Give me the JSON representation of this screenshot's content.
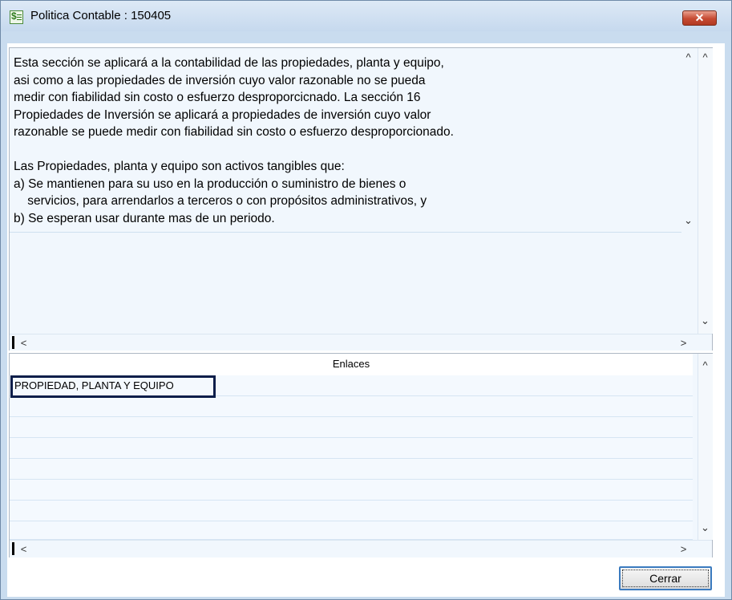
{
  "window": {
    "title": "Politica Contable : 150405",
    "close_label": "✕"
  },
  "policy_text": "Esta sección se aplicará a la contabilidad de las propiedades, planta y equipo,\nasi como a las propiedades de inversión cuyo valor razonable no se pueda\nmedir con fiabilidad sin costo o esfuerzo desproporcicnado. La sección 16\nPropiedades de Inversión se aplicará a propiedades de inversión cuyo valor\nrazonable se puede medir con fiabilidad sin costo o esfuerzo desproporcionado.\n\nLas Propiedades, planta y equipo son activos tangibles que:\na) Se mantienen para su uso en la producción o suministro de bienes o\n    servicios, para arrendarlos a terceros o con propósitos administrativos, y\nb) Se esperan usar durante mas de un periodo.",
  "enlaces": {
    "header": "Enlaces",
    "rows": [
      "PROPIEDAD, PLANTA Y EQUIPO",
      "",
      "",
      "",
      "",
      "",
      "",
      ""
    ]
  },
  "scroll": {
    "up": "^",
    "down": "⌄",
    "left": "<",
    "right": ">"
  },
  "buttons": {
    "close_label": "Cerrar"
  },
  "colors": {
    "panel_bg": "#f1f7fd",
    "frame": "#c9dcef",
    "selection": "#0b1e4a"
  }
}
